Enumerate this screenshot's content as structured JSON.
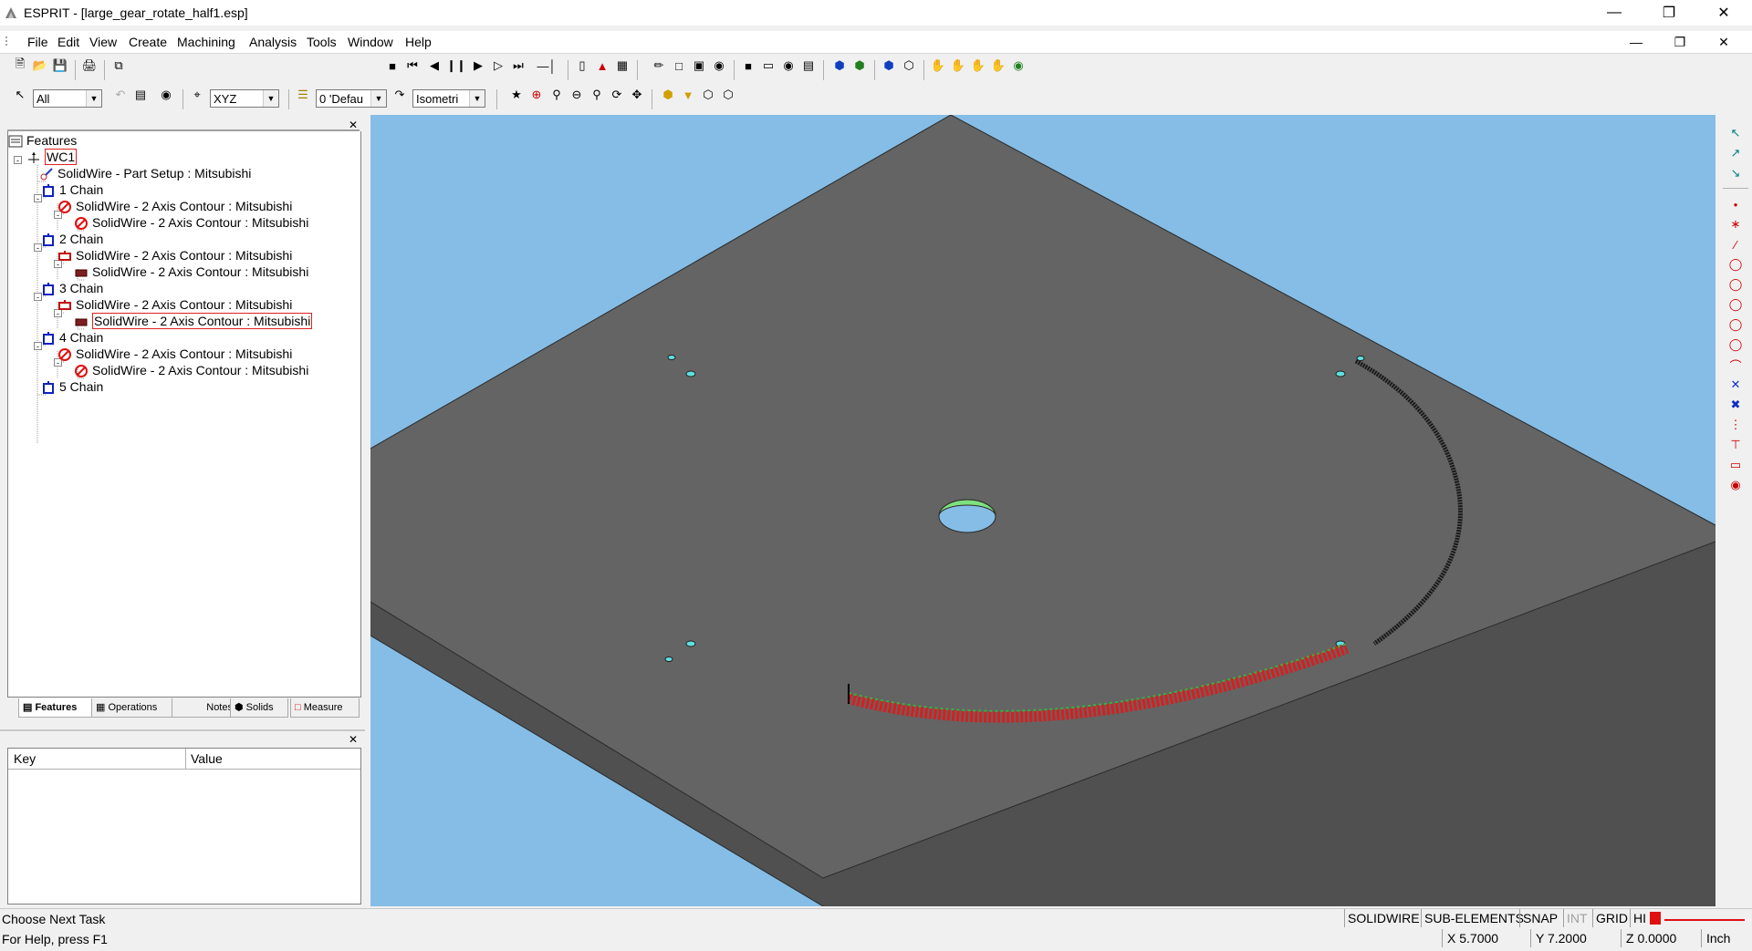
{
  "window": {
    "title": "ESPRIT - [large_gear_rotate_half1.esp]"
  },
  "menu": [
    "File",
    "Edit",
    "View",
    "Create",
    "Machining",
    "Analysis",
    "Tools",
    "Window",
    "Help"
  ],
  "toolbar": {
    "selection_filter": "All",
    "plane": "XYZ",
    "layer": "0 'Defau",
    "view_mode": "Isometri"
  },
  "tree": {
    "root": "Features",
    "items": [
      {
        "label": "WC1"
      },
      {
        "label": "SolidWire - Part Setup : Mitsubishi"
      },
      {
        "label": "1 Chain"
      },
      {
        "label": "SolidWire - 2 Axis Contour : Mitsubishi"
      },
      {
        "label": "SolidWire - 2 Axis Contour : Mitsubishi"
      },
      {
        "label": "2 Chain"
      },
      {
        "label": "SolidWire - 2 Axis Contour : Mitsubishi"
      },
      {
        "label": "SolidWire - 2 Axis Contour : Mitsubishi"
      },
      {
        "label": "3 Chain"
      },
      {
        "label": "SolidWire - 2 Axis Contour : Mitsubishi"
      },
      {
        "label": "SolidWire - 2 Axis Contour : Mitsubishi"
      },
      {
        "label": "4 Chain"
      },
      {
        "label": "SolidWire - 2 Axis Contour : Mitsubishi"
      },
      {
        "label": "SolidWire - 2 Axis Contour : Mitsubishi"
      },
      {
        "label": "5 Chain"
      }
    ]
  },
  "tabs": [
    "Features",
    "Operations",
    "Notes",
    "Solids",
    "Measure"
  ],
  "properties": {
    "key_header": "Key",
    "value_header": "Value"
  },
  "status": {
    "message": "Choose Next Task",
    "help": "For Help, press F1",
    "indicators": [
      "SOLIDWIRE",
      "SUB-ELEMENTS",
      "SNAP",
      "INT",
      "GRID",
      "HI"
    ],
    "x": "X 5.7000",
    "y": "Y 7.2000",
    "z": "Z 0.0000",
    "units": "Inch"
  },
  "colors": {
    "viewport_bg": "#85bde6",
    "plate": "#646464",
    "toolpath": "#d81e1e",
    "selection": "#e02020"
  }
}
